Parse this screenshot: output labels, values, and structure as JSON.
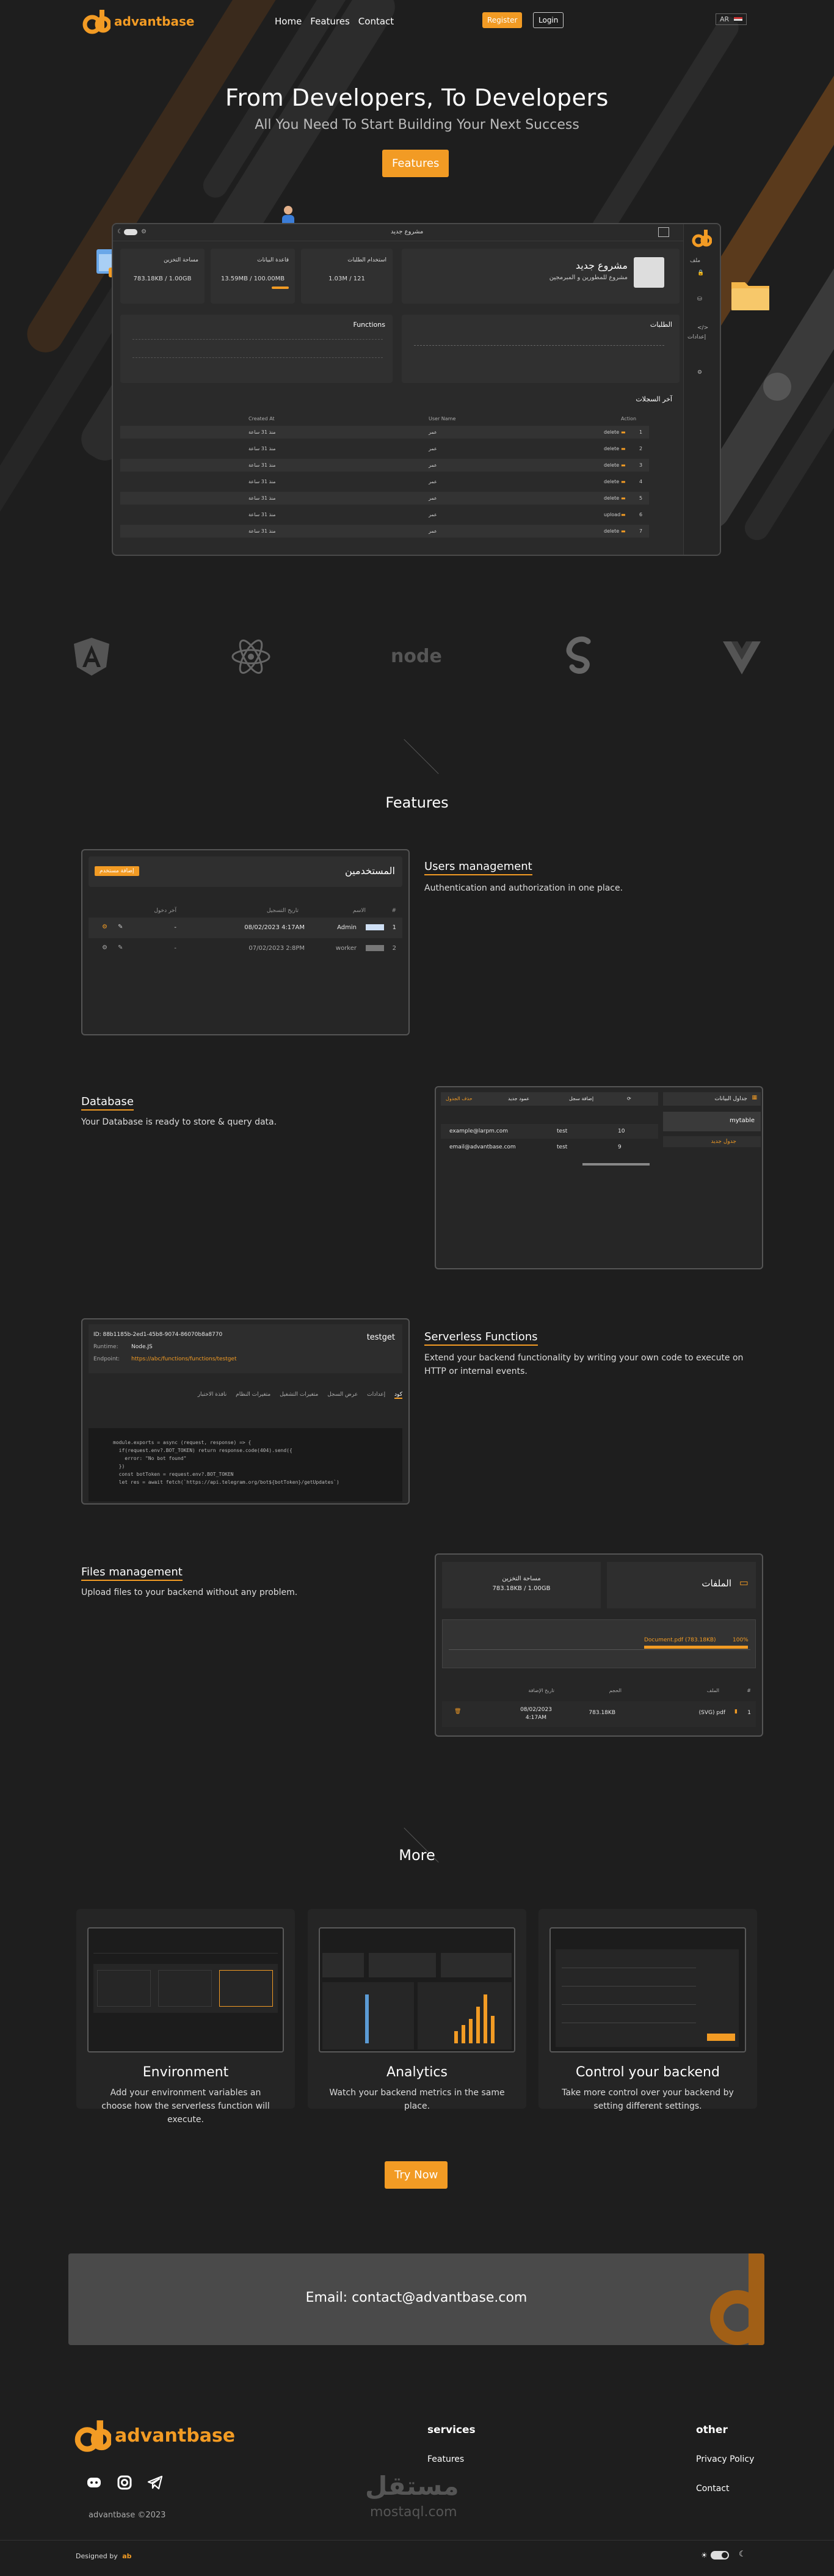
{
  "brand": {
    "name": "advantbase",
    "accent": "#f29b24",
    "bg": "#1e1e1e"
  },
  "nav": {
    "links": [
      "Home",
      "Features",
      "Contact"
    ],
    "register": "Register",
    "login": "Login",
    "lang": "AR"
  },
  "hero": {
    "title": "From Developers, To Developers",
    "subtitle": "All You Need To Start Building Your Next Success",
    "button": "Features"
  },
  "dashboard": {
    "topbar_title": "مشروع جديد",
    "project_name": "مشروع جديد",
    "project_desc": "مشروع للمطورين و المبرمجين",
    "sidebar_items": [
      "ملف",
      "إعدادات"
    ],
    "stats": [
      {
        "label": "مساحة التخزين",
        "value": "783.18KB / 1.00GB"
      },
      {
        "label": "قاعدة البيانات",
        "value": "13.59MB / 100.00MB"
      },
      {
        "label": "استخدام الطلبات",
        "value": "1.03M / 121"
      }
    ],
    "charts": [
      "Functions",
      "الطلبات"
    ],
    "records_title": "آخر السجلات",
    "records_headers": [
      "Created At",
      "User Name",
      "Action"
    ],
    "records": [
      {
        "n": "1",
        "date": "منذ 31 ساعة",
        "user": "عمر",
        "action": "delete"
      },
      {
        "n": "2",
        "date": "منذ 31 ساعة",
        "user": "عمر",
        "action": "delete"
      },
      {
        "n": "3",
        "date": "منذ 31 ساعة",
        "user": "عمر",
        "action": "delete"
      },
      {
        "n": "4",
        "date": "منذ 31 ساعة",
        "user": "عمر",
        "action": "delete"
      },
      {
        "n": "5",
        "date": "منذ 31 ساعة",
        "user": "عمر",
        "action": "delete"
      },
      {
        "n": "6",
        "date": "منذ 31 ساعة",
        "user": "عمر",
        "action": "upload"
      },
      {
        "n": "7",
        "date": "منذ 31 ساعة",
        "user": "عمر",
        "action": "delete"
      }
    ]
  },
  "tech": [
    "angular-logo",
    "react-logo",
    "node-logo",
    "svelte-logo",
    "vue-logo"
  ],
  "features": {
    "title": "Features",
    "items": [
      {
        "title": "Users management",
        "desc": "Authentication and authorization in one place."
      },
      {
        "title": "Database",
        "desc": "Your Database is ready to store & query data."
      },
      {
        "title": "Serverless Functions",
        "desc": "Extend your backend functionality by writing your own code to execute on HTTP or internal events."
      },
      {
        "title": "Files management",
        "desc": "Upload files to your backend without any problem."
      }
    ],
    "users_panel": {
      "title": "المستخدمين",
      "add_button": "إضافة مستخدم",
      "headers": [
        "#",
        "الاسم",
        "تاريخ التسجيل",
        "آخر دخول"
      ],
      "rows": [
        {
          "n": "1",
          "role": "Admin",
          "date": "08/02/2023 4:17AM",
          "last": "-"
        },
        {
          "n": "2",
          "role": "worker",
          "date": "07/02/2023 2:8PM",
          "last": "-"
        }
      ]
    },
    "db_panel": {
      "title": "جداول البيانات",
      "table_name": "mytable",
      "add_table": "جدول جديد",
      "add_column": "عمود جديد",
      "add_row": "إضافة سجل",
      "delete": "حذف الجدول",
      "rows": [
        {
          "email": "example@larpm.com",
          "user": "test",
          "n": "10"
        },
        {
          "email": "email@advantbase.com",
          "user": "test",
          "n": "9"
        }
      ]
    },
    "fn_panel": {
      "id": "ID: 88b1185b-2ed1-45b8-9074-86070b8a8770",
      "runtime_label": "Runtime:",
      "runtime": "Node.JS",
      "endpoint_label": "Endpoint:",
      "endpoint": "https://abc/functions/functions/testget",
      "name": "testget",
      "tabs": [
        "كود",
        "إعدادات",
        "عرض السجل",
        "متغيرات التشغيل",
        "متغيرات النظام",
        "نافذة الاختبار"
      ],
      "code": [
        "module.exports = async (request, response) => {",
        "  if(request.env?.BOT_TOKEN) return response.code(404).send({",
        "    error: \"No bot found\"",
        "  })",
        "",
        "  const botToken = request.env?.BOT_TOKEN",
        "",
        "  let res = await fetch(`https://api.telegram.org/bot${botToken}/getUpdates`)"
      ]
    },
    "files_panel": {
      "title": "الملفات",
      "storage_label": "مساحة التخزين",
      "storage": "783.18KB / 1.00GB",
      "upload_file": "Document.pdf (783.18KB)",
      "progress_label": "100%",
      "progress": 1.0,
      "headers": [
        "#",
        "الملف",
        "الحجم",
        "تاريخ الإضافة"
      ],
      "file": {
        "n": "1",
        "name": "(SVG) pdf",
        "size": "783.18KB",
        "date": "08/02/2023 4:17AM"
      }
    }
  },
  "more": {
    "title": "More",
    "cards": [
      {
        "title": "Environment",
        "desc": "Add your environment variables an choose how the serverless function will execute."
      },
      {
        "title": "Analytics",
        "desc": "Watch your backend metrics in the same place."
      },
      {
        "title": "Control your backend",
        "desc": "Take more control over your backend by setting different settings."
      }
    ]
  },
  "cta": {
    "button": "Try Now"
  },
  "contact": {
    "email": "Email: contact@advantbase.com"
  },
  "footer": {
    "services_title": "services",
    "services": [
      "Features"
    ],
    "other_title": "other",
    "other": [
      "Privacy Policy",
      "Contact"
    ],
    "copyright": "advantbase ©2023",
    "designed_by": "Designed by",
    "watermark": "مستقل",
    "watermark_sub": "mostaql.com"
  }
}
